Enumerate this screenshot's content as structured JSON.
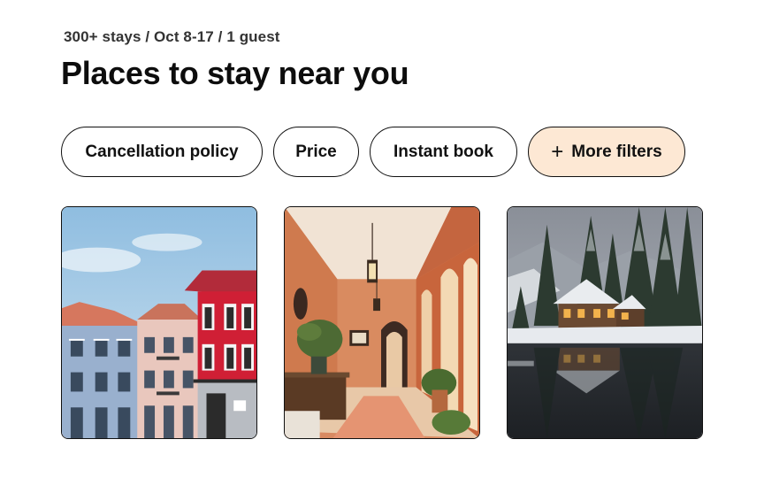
{
  "header": {
    "meta": "300+ stays / Oct 8-17 / 1 guest",
    "title": "Places to stay near you"
  },
  "filters": [
    {
      "label": "Cancellation policy"
    },
    {
      "label": "Price"
    },
    {
      "label": "Instant book"
    },
    {
      "label": "More filters",
      "icon": "plus-icon",
      "highlight": "#fde8d4"
    }
  ],
  "listings": [
    {
      "image": "colorful-townhouses-photo"
    },
    {
      "image": "terracotta-hallway-photo"
    },
    {
      "image": "snowy-lake-cabin-photo"
    }
  ],
  "colors": {
    "text": "#111111",
    "border": "#111111",
    "chip_highlight": "#fde8d4"
  }
}
